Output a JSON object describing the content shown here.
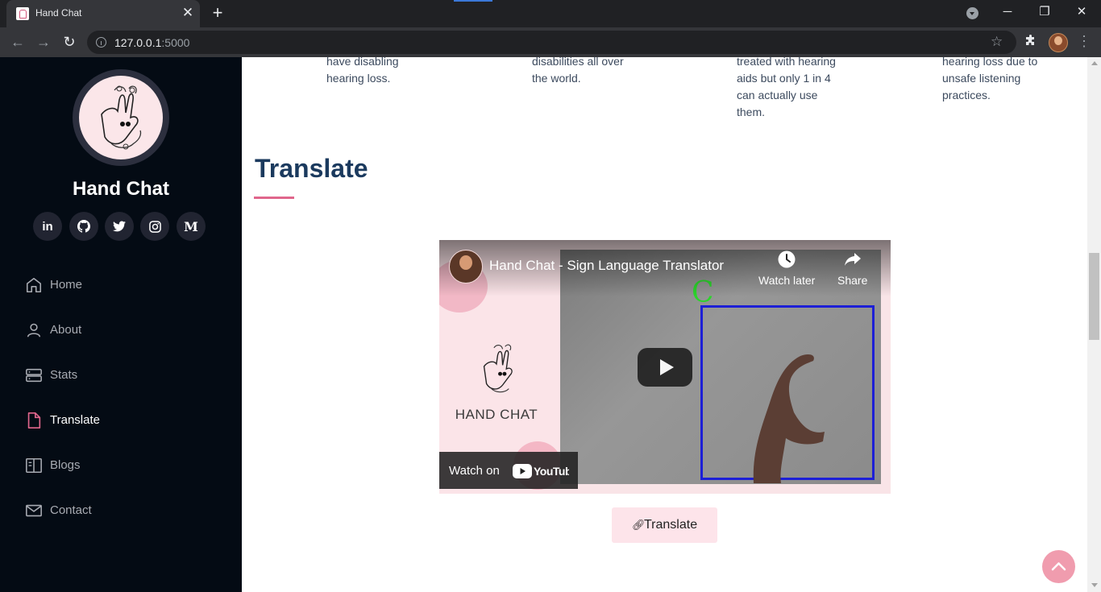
{
  "browser": {
    "tab_title": "Hand Chat",
    "tab_close": "✕",
    "new_tab": "+",
    "url_host": "127.0.0.1",
    "url_port": ":5000",
    "win_minimize": "─",
    "win_restore": "❐",
    "win_close": "✕",
    "menu": "⋮",
    "star": "☆",
    "back": "←",
    "forward": "→",
    "reload": "↻"
  },
  "sidebar": {
    "brand": "Hand Chat",
    "socials": [
      {
        "icon": "linkedin-icon",
        "label": "in"
      },
      {
        "icon": "github-icon",
        "label": ""
      },
      {
        "icon": "twitter-icon",
        "label": ""
      },
      {
        "icon": "instagram-icon",
        "label": ""
      },
      {
        "icon": "medium-icon",
        "label": "M"
      }
    ],
    "nav": [
      {
        "label": "Home",
        "icon": "home-icon"
      },
      {
        "label": "About",
        "icon": "person-icon"
      },
      {
        "label": "Stats",
        "icon": "server-icon"
      },
      {
        "label": "Translate",
        "icon": "document-icon",
        "active": true
      },
      {
        "label": "Blogs",
        "icon": "book-icon"
      },
      {
        "label": "Contact",
        "icon": "envelope-icon"
      }
    ],
    "active_color": "#e0668c"
  },
  "stats": [
    {
      "text": "have disabling hearing loss."
    },
    {
      "text": "disabilities all over the world."
    },
    {
      "text": "treated with hearing aids but only 1 in 4 can actually use them."
    },
    {
      "text": "hearing loss due to unsafe listening practices."
    }
  ],
  "translate_section": {
    "title": "Translate",
    "video": {
      "title": "Hand Chat - Sign Language Translator",
      "watch_later": "Watch later",
      "share": "Share",
      "watch_on": "Watch on",
      "youtube": "YouTube",
      "brand_caption": "HAND CHAT",
      "detected_letter": "C"
    },
    "button_label": "Translate"
  },
  "colors": {
    "sidebar_bg": "#040b14",
    "title": "#1b3a5e",
    "accent": "#e0668c"
  }
}
